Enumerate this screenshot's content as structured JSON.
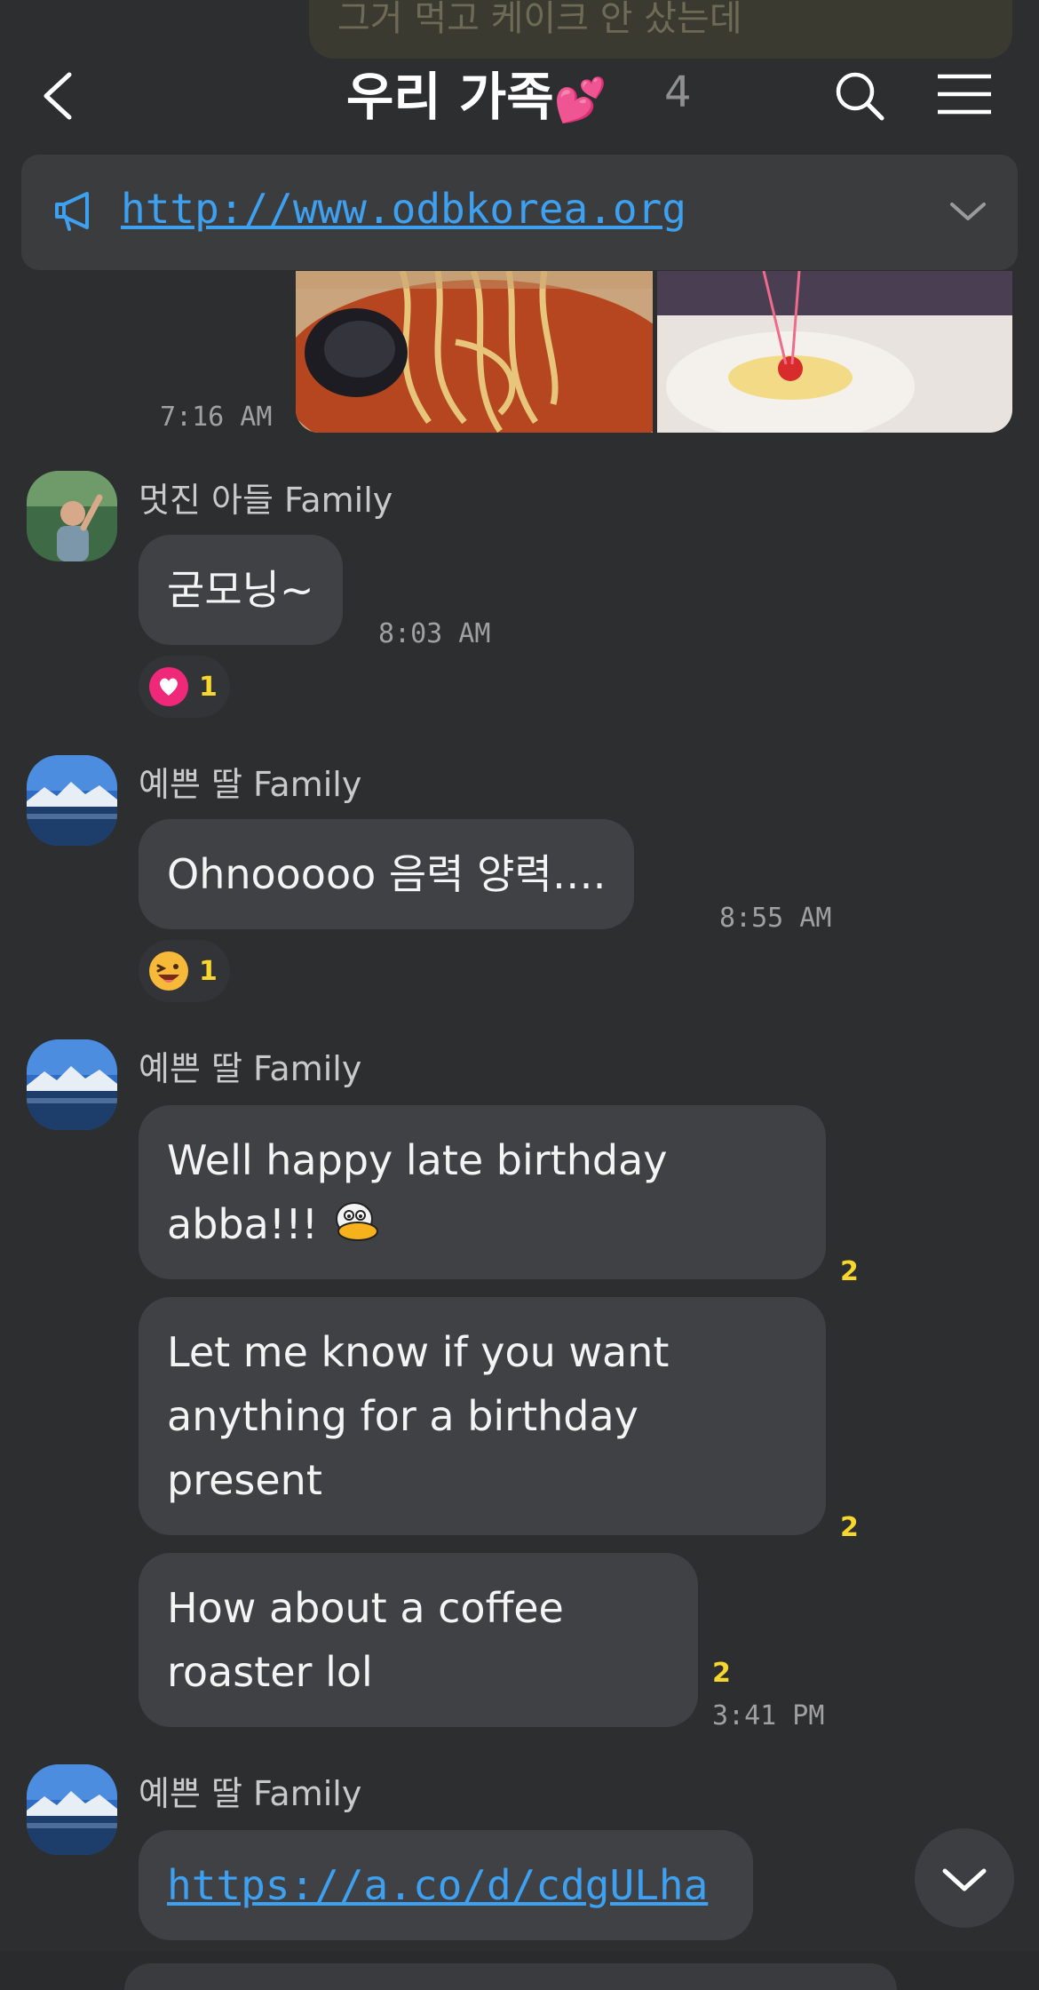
{
  "top_partial_text": "그거 먹고 케이크 안 샀는데",
  "header": {
    "title": "우리 가족",
    "title_emoji": "💕",
    "member_count": "4"
  },
  "notice": {
    "link": "http://www.odbkorea.org"
  },
  "photo_message": {
    "time": "7:16 AM"
  },
  "messages": [
    {
      "sender": "멋진 아들 Family",
      "bubbles": [
        "굳모닝~"
      ],
      "time": "8:03 AM",
      "reaction": {
        "icon": "heart-icon",
        "count": "1"
      }
    },
    {
      "sender": "예쁜 딸 Family",
      "bubbles": [
        "Ohnooooo 음력 양력…."
      ],
      "time": "8:55 AM",
      "reaction": {
        "icon": "grinning-face-icon",
        "count": "1"
      }
    },
    {
      "sender": "예쁜 딸 Family",
      "bubbles": [
        {
          "line1": "Well happy late birthday",
          "line2": "abba!!!",
          "unread": "2"
        },
        {
          "line1": "Let me know if you want",
          "line2": "anything for a birthday",
          "line3": "present",
          "unread": "2"
        },
        {
          "line1": "How about a coffee",
          "line2": "roaster lol",
          "unread": "2"
        }
      ],
      "time": "3:41 PM"
    },
    {
      "sender": "예쁜 딸 Family",
      "link": "https://a.co/d/cdgULha"
    }
  ],
  "colors": {
    "background": "#2d2e30",
    "bubble": "#404144",
    "link": "#3da0f0",
    "unread": "#f7d62d"
  }
}
